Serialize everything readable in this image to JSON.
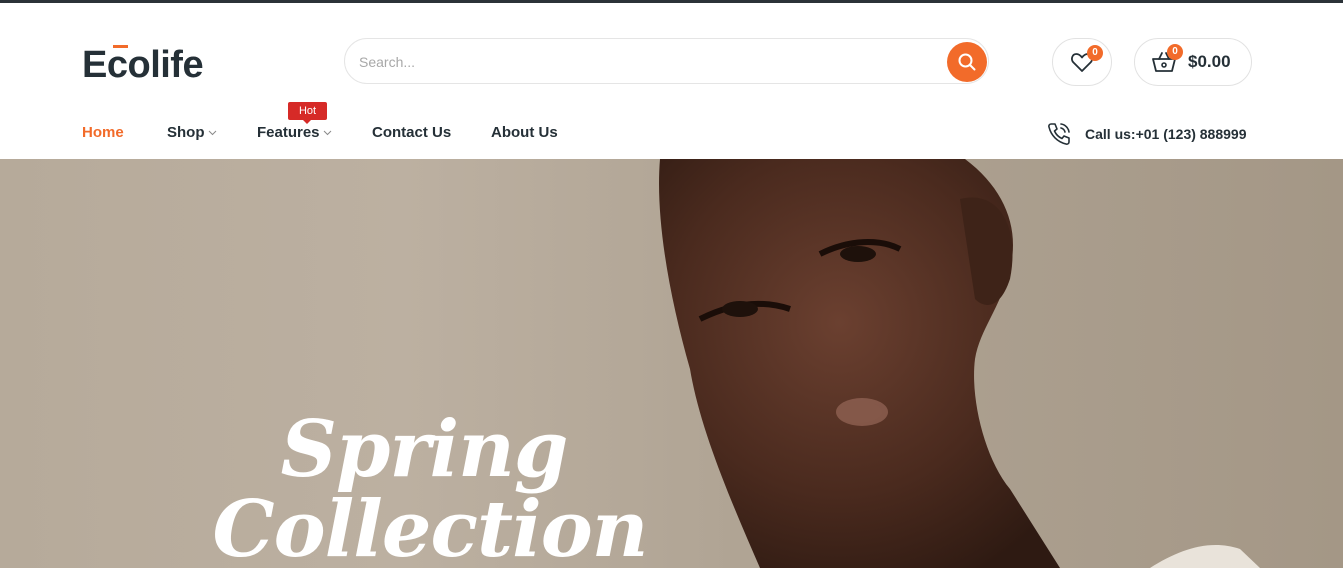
{
  "brand": {
    "name": "Ecolife"
  },
  "search": {
    "placeholder": "Search..."
  },
  "header": {
    "wishlist_count": "0",
    "cart_count": "0",
    "cart_total": "$0.00"
  },
  "nav": {
    "items": [
      {
        "label": "Home",
        "active": true
      },
      {
        "label": "Shop",
        "dropdown": true
      },
      {
        "label": "Features",
        "dropdown": true,
        "badge": "Hot"
      },
      {
        "label": "Contact Us"
      },
      {
        "label": "About Us"
      }
    ],
    "call": "Call us:+01 (123) 888999"
  },
  "hero": {
    "line1": "Spring",
    "line2": "Collection"
  },
  "colors": {
    "accent": "#f26b2a",
    "dark": "#253037",
    "hot": "#d62a27"
  }
}
